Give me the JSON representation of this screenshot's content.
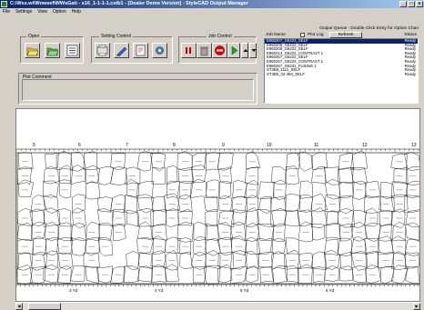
{
  "window": {
    "title": "C:\\Wss.wi\\Wowsef\\WWsGati - s16_1-1-1-1.cstb1 - [Dealer Demo Version] - StyleCAD Output Manager",
    "min": "_",
    "max": "□",
    "close": "x"
  },
  "menu": [
    "File",
    "Settings",
    "View",
    "Option",
    "Help"
  ],
  "groups": {
    "open": "Open",
    "setting": "Setting Control",
    "job": "Job Control"
  },
  "plot_comment": {
    "label": "Plot Comment",
    "value": ""
  },
  "queue": {
    "title": "Output Queue : Double Click Entry for Option Chan",
    "col_job": "Job Name",
    "plot_log": "Plot Log",
    "refresh": "Refresh",
    "col_status": "Status",
    "rows": [
      {
        "name": "E960207_G6222_SELF",
        "status": "Ready"
      },
      {
        "name": "E960206_G6222_SELF",
        "status": "Ready"
      },
      {
        "name": "E960208_G6222_SELF",
        "status": "Ready"
      },
      {
        "name": "E960213_G6222_CONTRAST 1",
        "status": "Ready"
      },
      {
        "name": "E960257_G6222_SELF",
        "status": "Ready"
      },
      {
        "name": "E960257_G6222_CONTRAST 1",
        "status": "Ready"
      },
      {
        "name": "E960257_G6222_FUSING 1",
        "status": "Ready"
      },
      {
        "name": "ST3B6_1111_SELF",
        "status": "Ready"
      },
      {
        "name": "ST3B6_02-484_SELF",
        "status": "Ready"
      }
    ]
  },
  "marker": {
    "top_ruler": [
      "5",
      "6",
      "7",
      "8",
      "9",
      "10",
      "11",
      "12",
      "13"
    ],
    "bottom_ruler": [
      "3 Yd",
      "4 Yd",
      "5 Yd",
      "6 Yd"
    ]
  },
  "colors": {
    "titlebar": "#0a246a",
    "selection": "#0a246a",
    "face": "#d4d0c8"
  }
}
